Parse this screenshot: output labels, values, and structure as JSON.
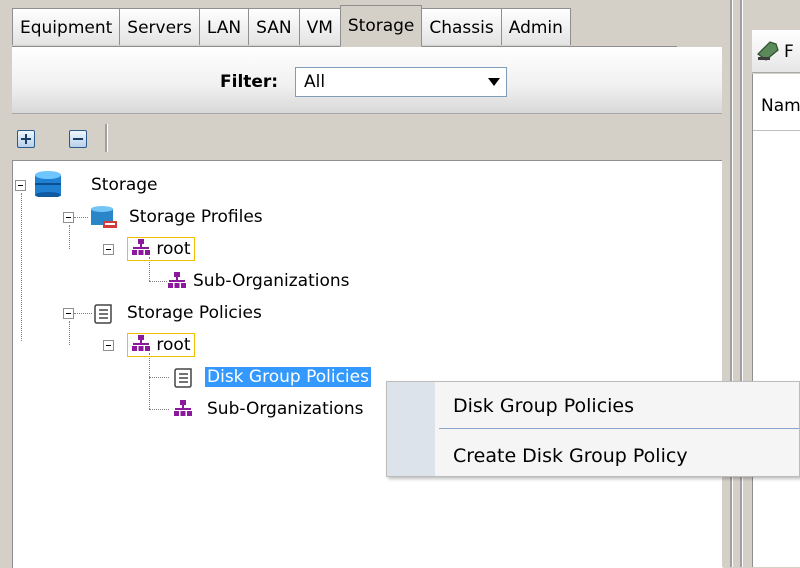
{
  "tabs": [
    {
      "label": "Equipment",
      "active": false
    },
    {
      "label": "Servers",
      "active": false
    },
    {
      "label": "LAN",
      "active": false
    },
    {
      "label": "SAN",
      "active": false
    },
    {
      "label": "VM",
      "active": false
    },
    {
      "label": "Storage",
      "active": true
    },
    {
      "label": "Chassis",
      "active": false
    },
    {
      "label": "Admin",
      "active": false
    }
  ],
  "filter": {
    "label": "Filter:",
    "value": "All"
  },
  "toolbar": {
    "expand_icon": "plus-icon",
    "collapse_icon": "minus-icon"
  },
  "tree": {
    "root": "Storage",
    "storage_profiles": "Storage Profiles",
    "profiles_root": "root",
    "profiles_suborg": "Sub-Organizations",
    "storage_policies": "Storage Policies",
    "policies_root": "root",
    "disk_group_policies": "Disk Group Policies",
    "policies_suborg": "Sub-Organizations",
    "selected": "Disk Group Policies"
  },
  "right_panel": {
    "title": "F",
    "column_header": "Nam"
  },
  "context_menu": {
    "items": [
      "Disk Group Policies",
      "Create Disk Group Policy"
    ]
  },
  "colors": {
    "selection": "#3399ff",
    "org_icon": "#8a1a9b",
    "highlight_border": "#f0c000",
    "panel_bg": "#d4d0c8"
  }
}
